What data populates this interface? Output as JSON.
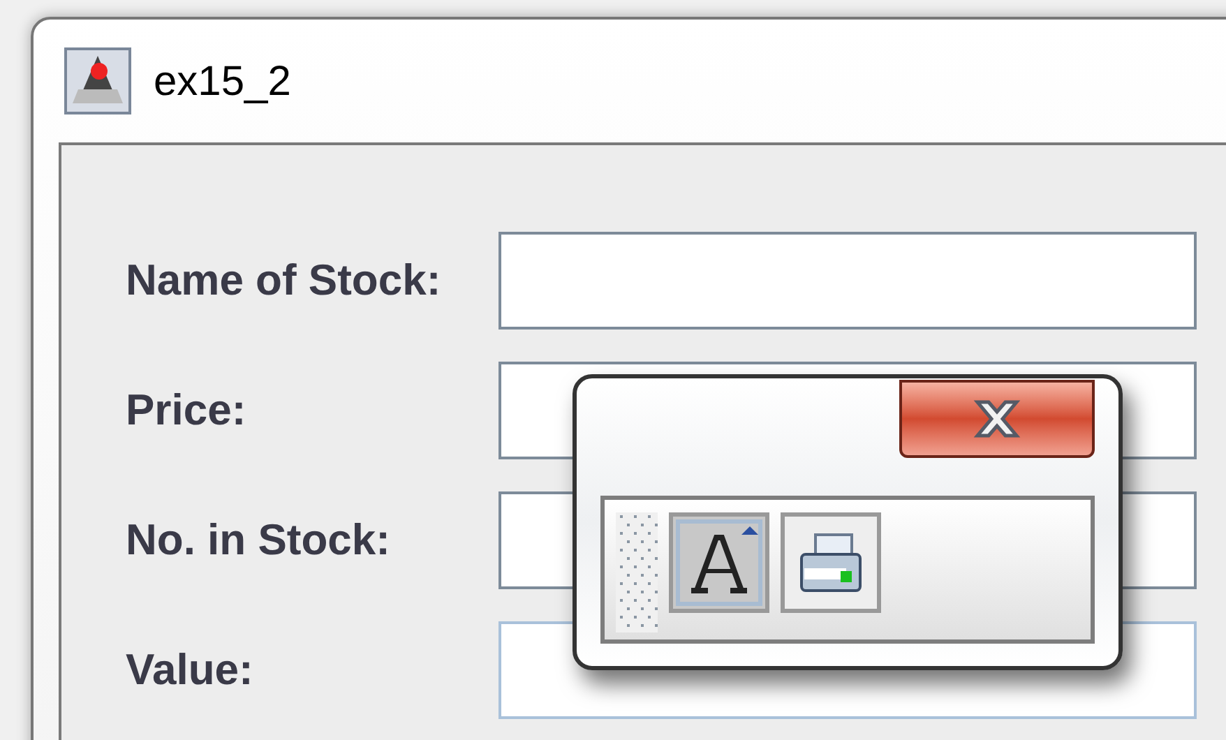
{
  "window": {
    "title": "ex15_2"
  },
  "fields": [
    {
      "label": "Name of Stock:",
      "focused": false
    },
    {
      "label": "Price:",
      "focused": false
    },
    {
      "label": "No. in Stock:",
      "focused": false
    },
    {
      "label": "Value:",
      "focused": true
    }
  ],
  "floating_toolbar": {
    "buttons": [
      {
        "kind": "font",
        "selected": true
      },
      {
        "kind": "print",
        "selected": false
      }
    ]
  }
}
